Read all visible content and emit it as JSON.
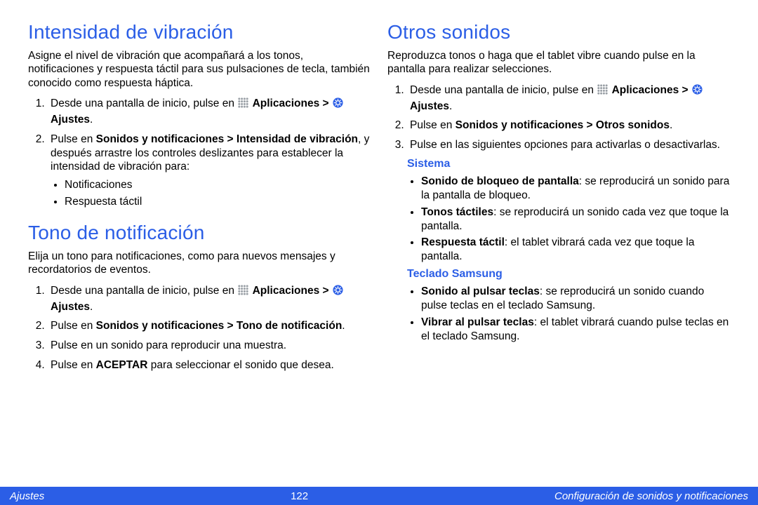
{
  "left": {
    "section1": {
      "title": "Intensidad de vibración",
      "intro": "Asigne el nivel de vibración que acompañará a los tonos, notificaciones y respuesta táctil para sus pulsaciones de tecla, también conocido como respuesta háptica.",
      "step1a": "Desde una pantalla de inicio, pulse en ",
      "step1b": "Aplicaciones > ",
      "step1c": " Ajustes",
      "step1d": ".",
      "step2a": "Pulse en ",
      "step2b": "Sonidos y notificaciones > Intensidad de vibración",
      "step2c": ", y después arrastre los controles deslizantes para establecer la intensidad de vibración para:",
      "bullet1": "Notificaciones",
      "bullet2": "Respuesta táctil"
    },
    "section2": {
      "title": "Tono de notificación",
      "intro": "Elija un tono para notificaciones, como para nuevos mensajes y recordatorios de eventos.",
      "step1a": "Desde una pantalla de inicio, pulse en ",
      "step1b": "Aplicaciones > ",
      "step1c": " Ajustes",
      "step1d": ".",
      "step2a": "Pulse en ",
      "step2b": "Sonidos y notificaciones > Tono de notificación",
      "step2c": ".",
      "step3": "Pulse en un sonido para reproducir una muestra.",
      "step4a": "Pulse en ",
      "step4b": "ACEPTAR",
      "step4c": " para seleccionar el sonido que desea."
    }
  },
  "right": {
    "section1": {
      "title": "Otros sonidos",
      "intro": "Reproduzca tonos o haga que el tablet vibre cuando pulse en la pantalla para realizar selecciones.",
      "step1a": "Desde una pantalla de inicio, pulse en ",
      "step1b": "Aplicaciones > ",
      "step1c": " Ajustes",
      "step1d": ".",
      "step2a": "Pulse en ",
      "step2b": "Sonidos y notificaciones > Otros sonidos",
      "step2c": ".",
      "step3": "Pulse en las siguientes opciones para activarlas o desactivarlas.",
      "sub1": "Sistema",
      "s1b1a": "Sonido de bloqueo de pantalla",
      "s1b1b": ": se reproducirá un sonido para la pantalla de bloqueo.",
      "s1b2a": "Tonos táctiles",
      "s1b2b": ": se reproducirá un sonido cada vez que toque la pantalla.",
      "s1b3a": "Respuesta táctil",
      "s1b3b": ": el tablet vibrará cada vez que toque la pantalla.",
      "sub2": "Teclado Samsung",
      "s2b1a": "Sonido al pulsar teclas",
      "s2b1b": ": se reproducirá un sonido cuando pulse teclas en el teclado Samsung.",
      "s2b2a": "Vibrar al pulsar teclas",
      "s2b2b": ": el tablet vibrará cuando pulse teclas en el teclado Samsung."
    }
  },
  "footer": {
    "left": "Ajustes",
    "center": "122",
    "right": "Configuración de sonidos y notificaciones"
  }
}
